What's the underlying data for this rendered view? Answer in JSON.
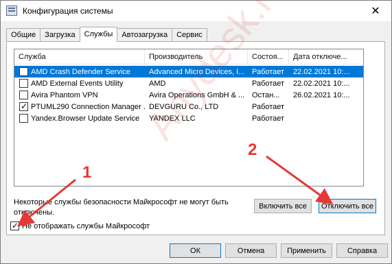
{
  "window": {
    "title": "Конфигурация системы",
    "close_glyph": "✕"
  },
  "tabs": [
    {
      "label": "Общие"
    },
    {
      "label": "Загрузка"
    },
    {
      "label": "Службы"
    },
    {
      "label": "Автозагрузка"
    },
    {
      "label": "Сервис"
    }
  ],
  "active_tab": "Службы",
  "services": {
    "columns": [
      "Служба",
      "Производитель",
      "Состоя...",
      "Дата отключе..."
    ],
    "rows": [
      {
        "checked": false,
        "name": "AMD Crash Defender Service",
        "vendor": "Advanced Micro Devices, I...",
        "status": "Работает",
        "date": "22.02.2021 10:..."
      },
      {
        "checked": false,
        "name": "AMD External Events Utility",
        "vendor": "AMD",
        "status": "Работает",
        "date": "22.02.2021 10:..."
      },
      {
        "checked": false,
        "name": "Avira Phantom VPN",
        "vendor": "Avira Operations GmbH & ...",
        "status": "Остан...",
        "date": "26.02.2021 10:..."
      },
      {
        "checked": true,
        "name": "PTUML290 Connection Manager ...",
        "vendor": "DEVGURU Co., LTD",
        "status": "Работает",
        "date": ""
      },
      {
        "checked": false,
        "name": "Yandex.Browser Update Service",
        "vendor": "YANDEX LLC",
        "status": "Работает",
        "date": ""
      }
    ]
  },
  "note": "Некоторые службы безопасности Майкрософт не могут быть отключены.",
  "enable_all_label": "Включить все",
  "disable_all_label": "Отключить все",
  "hide_microsoft": {
    "checked": true,
    "label": "Не отображать службы Майкрософт"
  },
  "footer": {
    "ok": "ОК",
    "cancel": "Отмена",
    "apply": "Применить",
    "help": "Справка"
  },
  "annotations": {
    "marker1": "1",
    "marker2": "2",
    "color": "#e53935"
  },
  "watermark": "Anydesk.help"
}
